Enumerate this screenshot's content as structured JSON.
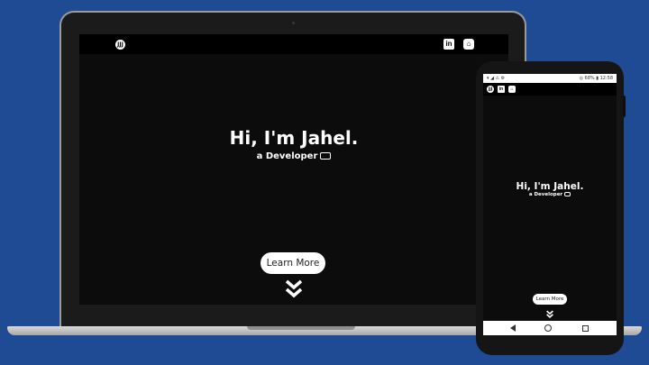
{
  "site": {
    "logo_text": "JJJ",
    "linkedin_label": "in",
    "github_label": "⌂",
    "hero_title": "Hi, I'm Jahel.",
    "hero_subtitle": "a Developer",
    "learn_more": "Learn More"
  },
  "phone_status": {
    "left_icons": "▾ ◢ ⚠ ⚙",
    "right_text": "◎ 68% ▮ 12:58"
  },
  "colors": {
    "background": "#1f4a94",
    "screen": "#0c0c0c",
    "navbar": "#000000",
    "button": "#ffffff"
  }
}
